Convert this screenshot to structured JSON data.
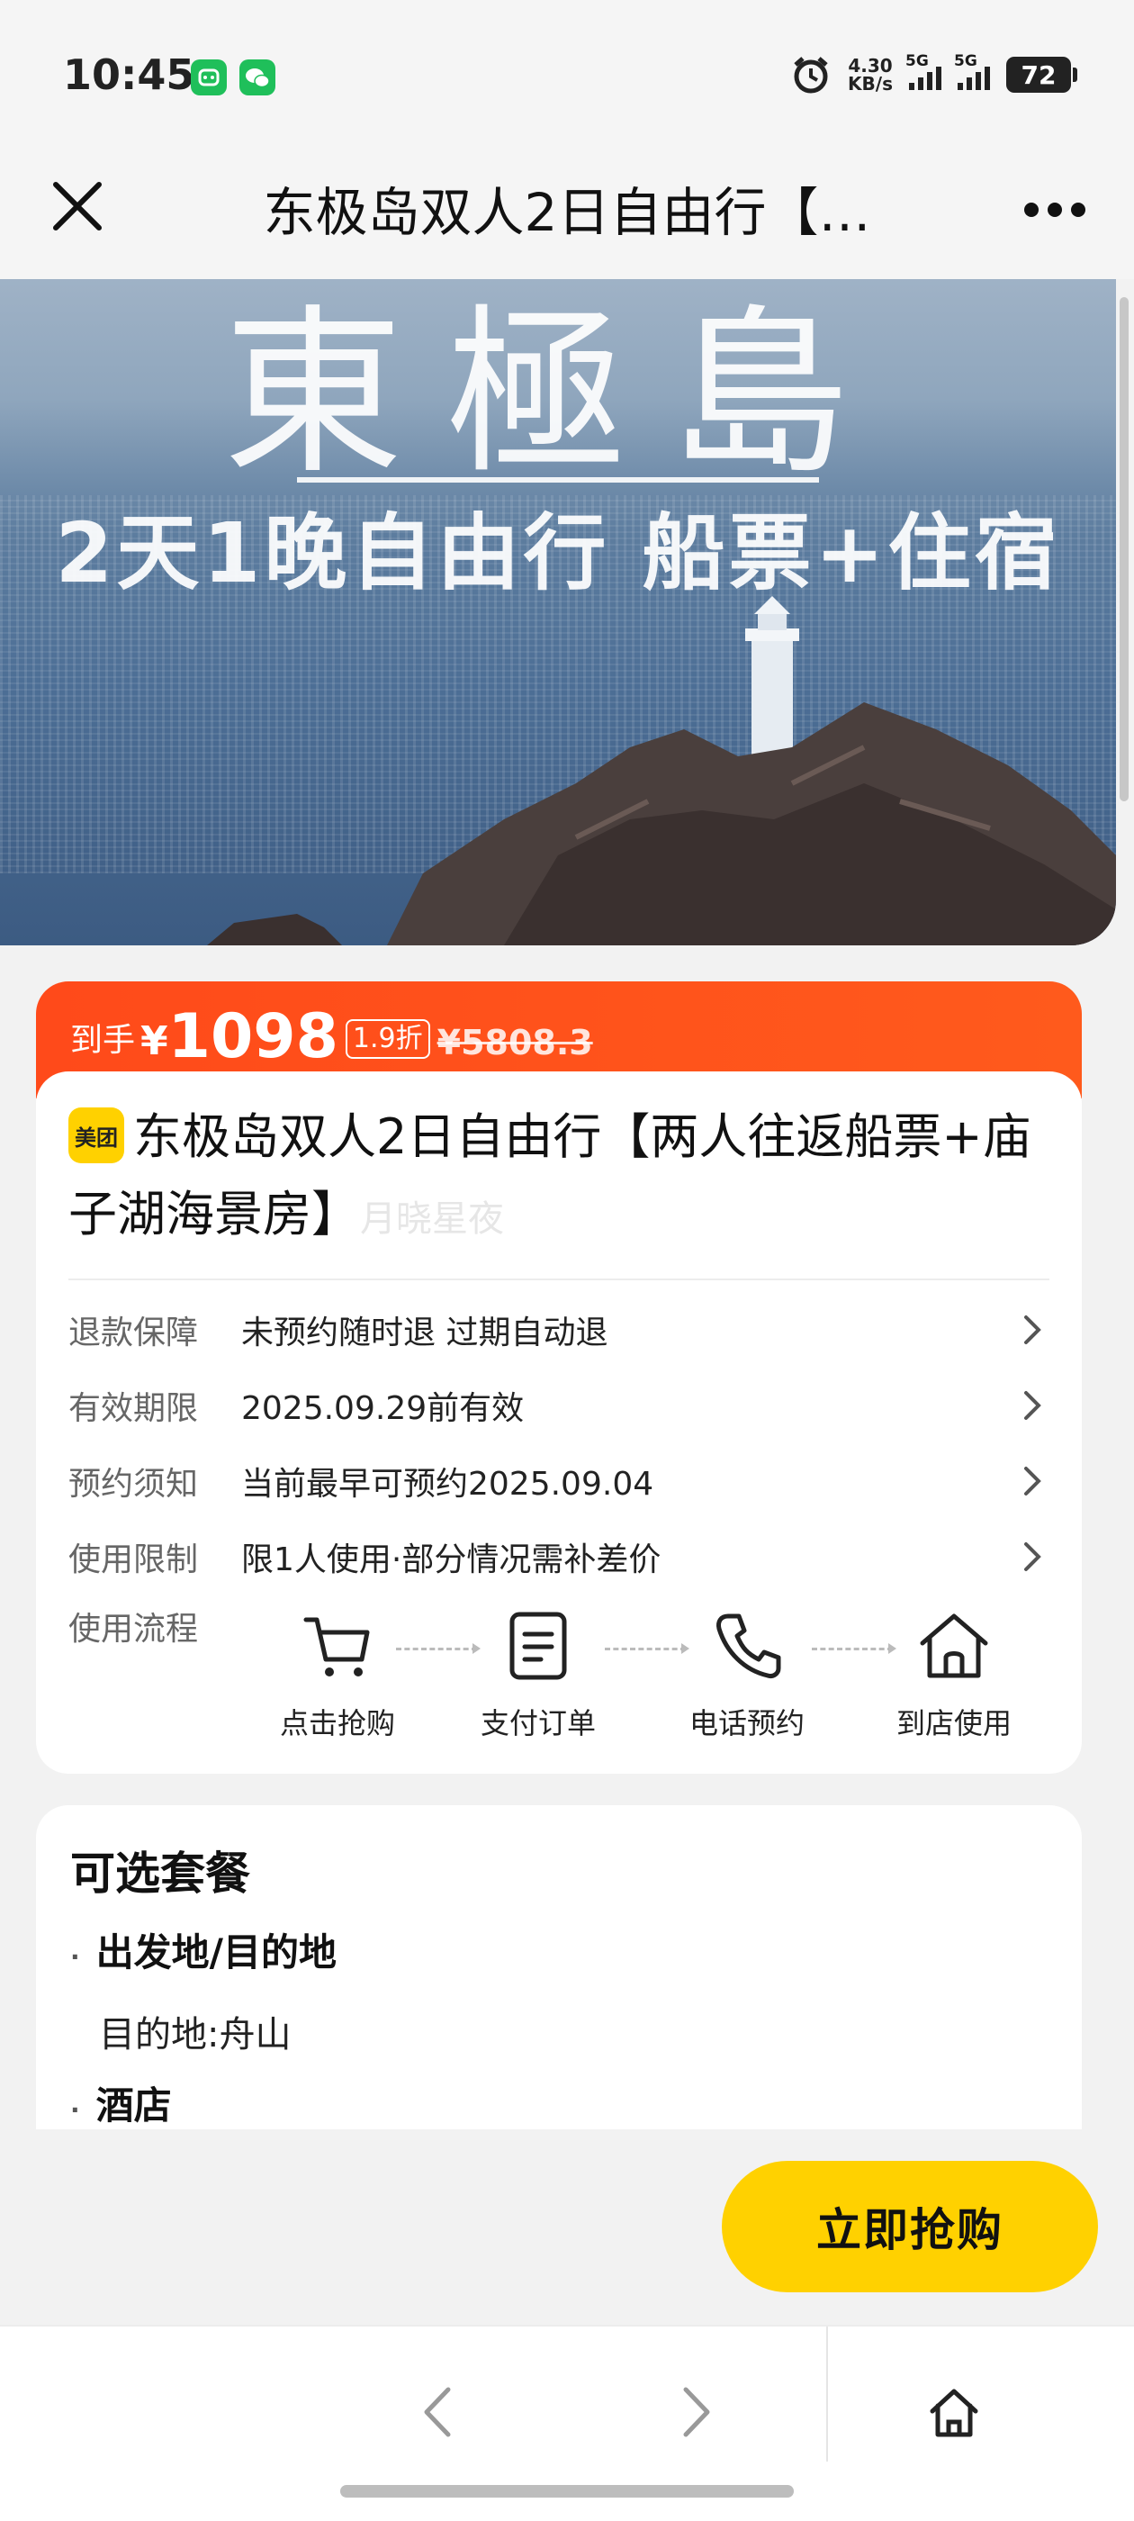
{
  "status_bar": {
    "time": "10:45",
    "net_speed_value": "4.30",
    "net_speed_unit": "KB/s",
    "signal1_label": "5G",
    "signal2_label": "5G",
    "battery": "72",
    "icons": [
      "alarm-icon",
      "app-icon",
      "wechat-icon"
    ]
  },
  "header": {
    "title": "东极岛双人2日自由行【…"
  },
  "hero": {
    "title": "東極島",
    "subtitle": "2天1晚自由行 船票+住宿"
  },
  "price": {
    "label": "到手",
    "currency": "¥",
    "amount": "1098",
    "discount": "1.9折",
    "original": "¥5808.3",
    "accent_color": "#ff4a1a"
  },
  "product": {
    "brand_badge": "美团",
    "title": "东极岛双人2日自由行【两人往返船票+庙子湖海景房】",
    "watermark": "月晓星夜"
  },
  "info_rows": [
    {
      "key": "退款保障",
      "value": "未预约随时退 过期自动退"
    },
    {
      "key": "有效期限",
      "value": "2025.09.29前有效"
    },
    {
      "key": "预约须知",
      "value": "当前最早可预约2025.09.04"
    },
    {
      "key": "使用限制",
      "value": "限1人使用·部分情况需补差价"
    }
  ],
  "flow": {
    "label": "使用流程",
    "steps": [
      "点击抢购",
      "支付订单",
      "电话预约",
      "到店使用"
    ]
  },
  "packages": {
    "title": "可选套餐",
    "items": [
      {
        "name": "出发地/目的地",
        "value": "目的地:舟山"
      },
      {
        "name": "酒店",
        "value": ""
      }
    ]
  },
  "cta": {
    "buy_label": "立即抢购",
    "color": "#ffd100"
  }
}
